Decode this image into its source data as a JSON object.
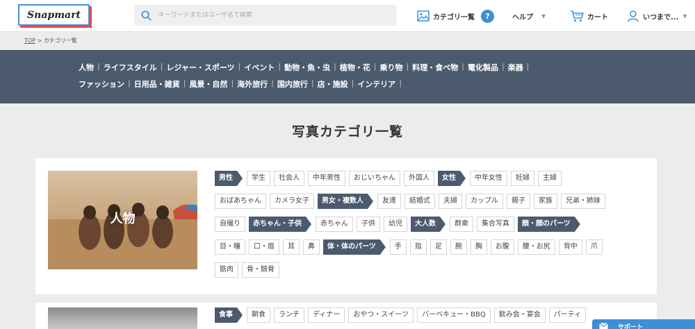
{
  "header": {
    "logo_text": "Snapmart",
    "search_placeholder": "キーワードまたはユーザ名で検索",
    "nav": {
      "categories": "カテゴリ一覧",
      "help_badge": "?",
      "help": "ヘルプ",
      "cart": "カート",
      "user": "いつまで..."
    },
    "colors": {
      "accent": "#3d8fd6",
      "band": "#4c5a6e"
    }
  },
  "breadcrumb": {
    "top": "TOP",
    "separator": ">",
    "current": "カテゴリ一覧"
  },
  "category_band": {
    "row1": [
      "人物",
      "ライフスタイル",
      "レジャー・スポーツ",
      "イベント",
      "動物・魚・虫",
      "植物・花",
      "乗り物",
      "料理・食べ物",
      "電化製品",
      "楽器"
    ],
    "row2": [
      "ファッション",
      "日用品・雑貨",
      "風景・自然",
      "海外旅行",
      "国内旅行",
      "店・施設",
      "インテリア"
    ],
    "separator": "|"
  },
  "page_title": "写真カテゴリ一覧",
  "section_people": {
    "thumb_label": "人物",
    "rows": [
      [
        {
          "t": "男性",
          "main": true
        },
        {
          "t": "学生"
        },
        {
          "t": "社会人"
        },
        {
          "t": "中年男性"
        },
        {
          "t": "おじいちゃん"
        },
        {
          "t": "外国人"
        },
        {
          "t": "女性",
          "main": true
        },
        {
          "t": "中年女性"
        },
        {
          "t": "妊婦"
        },
        {
          "t": "主婦"
        }
      ],
      [
        {
          "t": "おばあちゃん"
        },
        {
          "t": "カメラ女子"
        },
        {
          "t": "男女・複数人",
          "main": true
        },
        {
          "t": "友達"
        },
        {
          "t": "結婚式"
        },
        {
          "t": "夫婦"
        },
        {
          "t": "カップル"
        },
        {
          "t": "親子"
        },
        {
          "t": "家族"
        },
        {
          "t": "兄弟・姉妹"
        }
      ],
      [
        {
          "t": "自撮り"
        },
        {
          "t": "赤ちゃん・子供",
          "main": true
        },
        {
          "t": "赤ちゃん"
        },
        {
          "t": "子供"
        },
        {
          "t": "幼児"
        },
        {
          "t": "大人数",
          "main": true
        },
        {
          "t": "群衆"
        },
        {
          "t": "集合写真"
        },
        {
          "t": "顔・顔のパーツ",
          "main": true
        }
      ],
      [
        {
          "t": "目・瞳"
        },
        {
          "t": "口・唇"
        },
        {
          "t": "耳"
        },
        {
          "t": "鼻"
        },
        {
          "t": "体・体のパーツ",
          "main": true
        },
        {
          "t": "手"
        },
        {
          "t": "指"
        },
        {
          "t": "足"
        },
        {
          "t": "腕"
        },
        {
          "t": "胸"
        },
        {
          "t": "お腹"
        },
        {
          "t": "腰・お尻"
        },
        {
          "t": "背中"
        },
        {
          "t": "爪"
        }
      ],
      [
        {
          "t": "筋肉"
        },
        {
          "t": "骨・骸骨"
        }
      ]
    ]
  },
  "section_food": {
    "rows": [
      [
        {
          "t": "食事",
          "main": true
        },
        {
          "t": "朝食"
        },
        {
          "t": "ランチ"
        },
        {
          "t": "ディナー"
        },
        {
          "t": "おやつ・スイーツ"
        },
        {
          "t": "バーベキュー・BBQ"
        },
        {
          "t": "飲み会・宴会"
        },
        {
          "t": "パーティ"
        }
      ]
    ]
  },
  "support": {
    "label": "サポート"
  }
}
